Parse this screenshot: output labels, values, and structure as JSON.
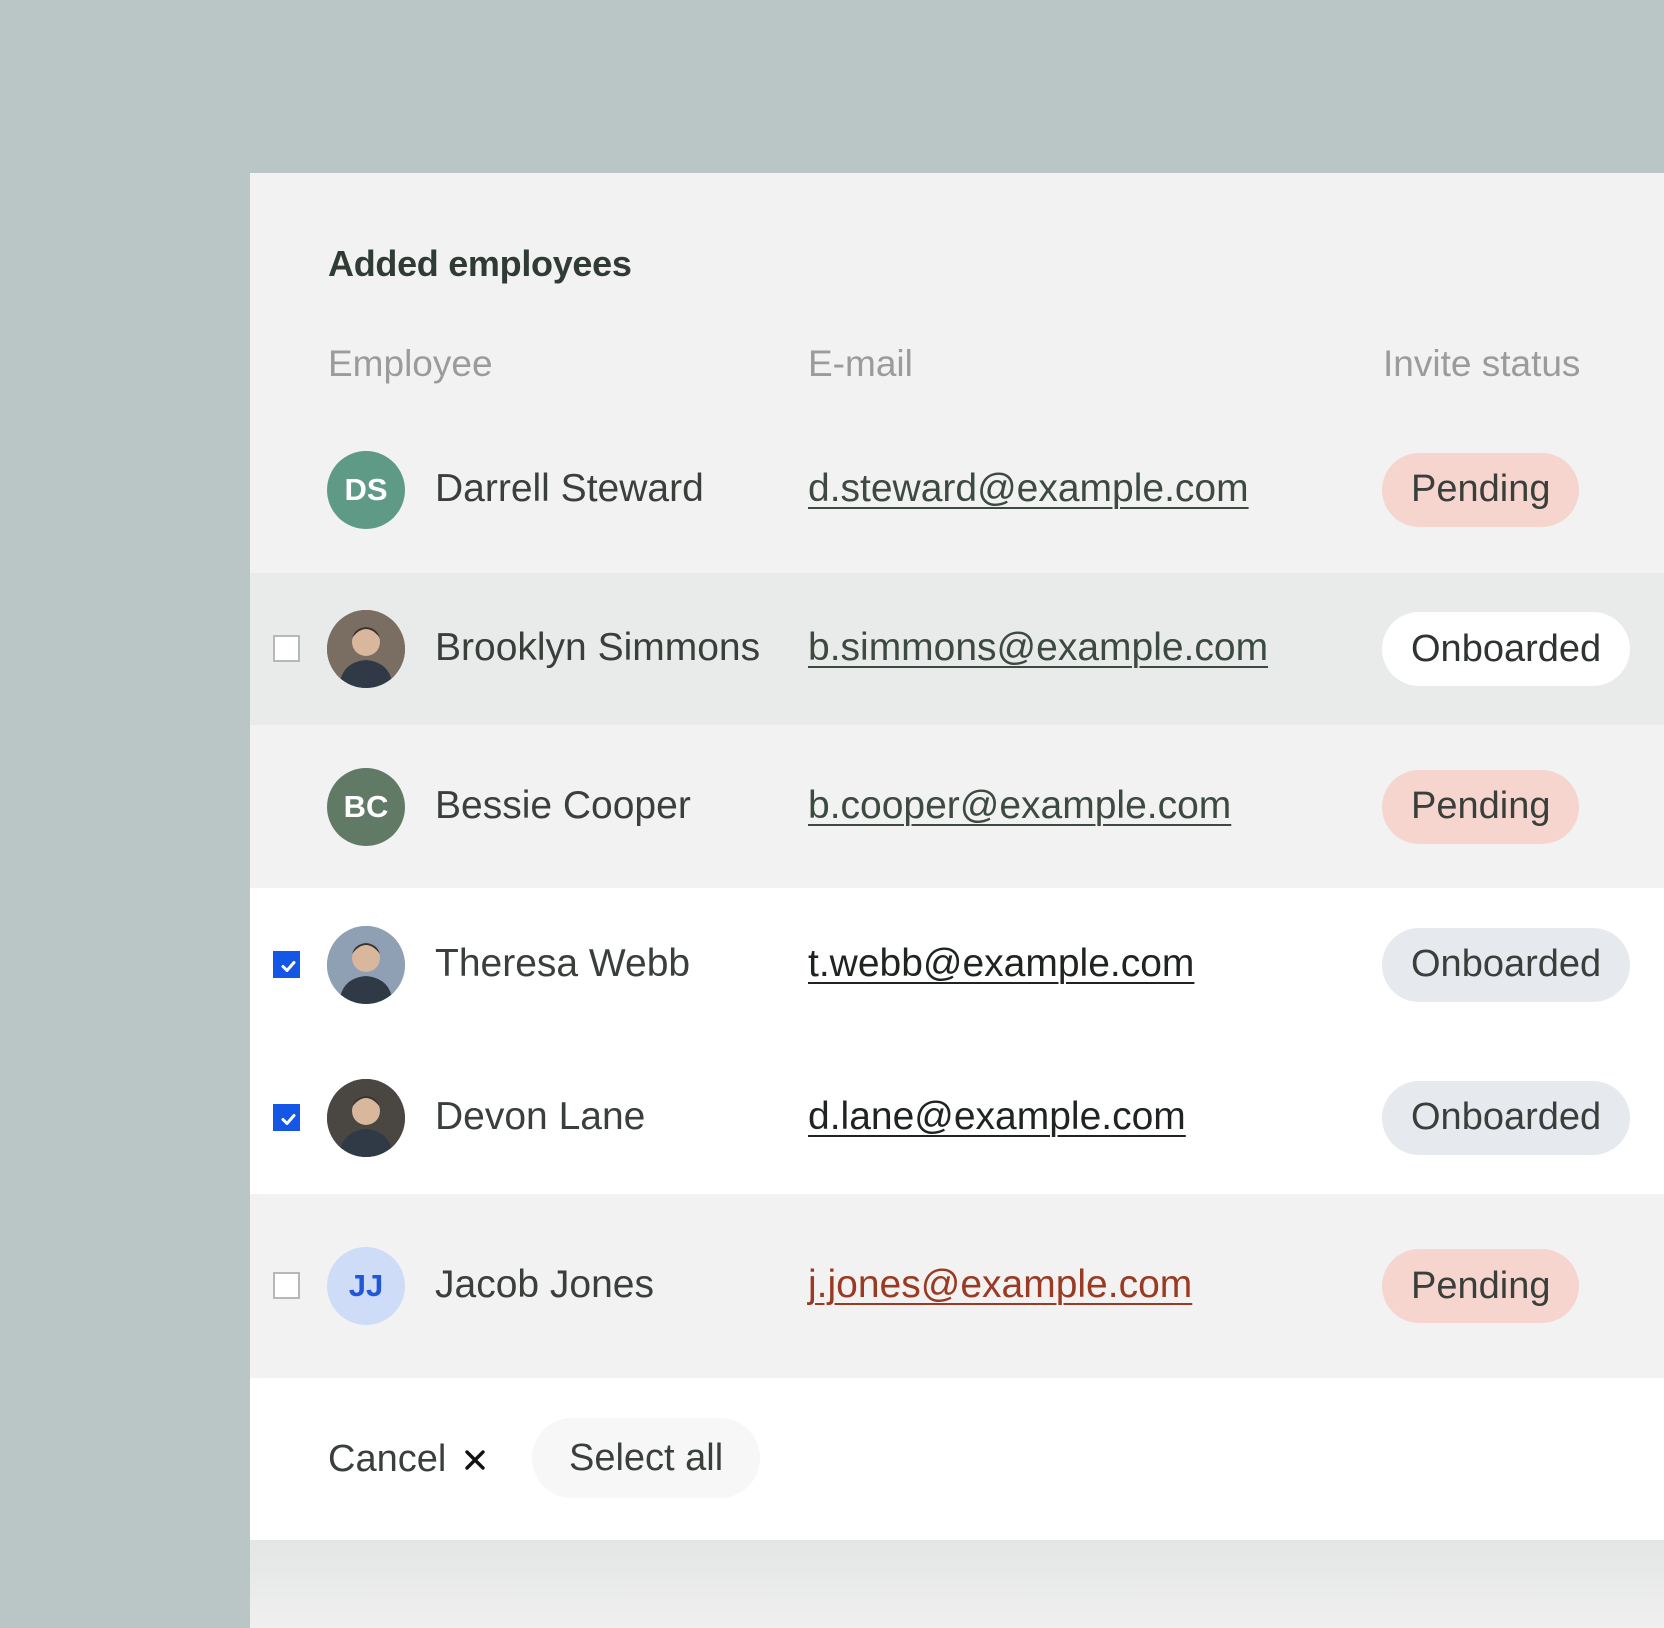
{
  "header": {
    "title": "Added employees"
  },
  "columns": {
    "employee": "Employee",
    "email": "E-mail",
    "status": "Invite status"
  },
  "rows": [
    {
      "name": "Darrell Steward",
      "email": "d.steward@example.com",
      "status": "Pending",
      "initials": "DS",
      "avatar_type": "initials",
      "avatar_bg": "#5f9a87",
      "avatar_fg": "#ffffff",
      "checkbox": "none",
      "row_bg": "#f2f2f2",
      "email_color": "#3d4a42",
      "badge_bg": "#f6d5cf",
      "badge_fg": "#3a3f3c"
    },
    {
      "name": "Brooklyn Simmons",
      "email": "b.simmons@example.com",
      "status": "Onboarded",
      "initials": "",
      "avatar_type": "photo",
      "avatar_bg": "#7a6e63",
      "avatar_fg": "#ffffff",
      "checkbox": "unchecked",
      "row_bg": "#e8ebe9",
      "email_color": "#3d4a42",
      "badge_bg": "#ffffff",
      "badge_fg": "#2f3431"
    },
    {
      "name": "Bessie Cooper",
      "email": "b.cooper@example.com",
      "status": "Pending",
      "initials": "BC",
      "avatar_type": "initials",
      "avatar_bg": "#617a66",
      "avatar_fg": "#ffffff",
      "checkbox": "none",
      "row_bg": "#f2f2f2",
      "email_color": "#3d4a42",
      "badge_bg": "#f6d5cf",
      "badge_fg": "#3a3f3c"
    },
    {
      "name": "Theresa Webb",
      "email": "t.webb@example.com",
      "status": "Onboarded",
      "initials": "",
      "avatar_type": "photo",
      "avatar_bg": "#8fa0b5",
      "avatar_fg": "#ffffff",
      "checkbox": "checked",
      "row_bg": "#ffffff",
      "email_color": "#1f2420",
      "badge_bg": "#e6e9ee",
      "badge_fg": "#3a3f3c"
    },
    {
      "name": "Devon Lane",
      "email": "d.lane@example.com",
      "status": "Onboarded",
      "initials": "",
      "avatar_type": "photo",
      "avatar_bg": "#4a4742",
      "avatar_fg": "#ffffff",
      "checkbox": "checked",
      "row_bg": "#ffffff",
      "email_color": "#1f2420",
      "badge_bg": "#e6e9ee",
      "badge_fg": "#3a3f3c"
    },
    {
      "name": "Jacob Jones",
      "email": "j.jones@example.com",
      "status": "Pending",
      "initials": "JJ",
      "avatar_type": "initials",
      "avatar_bg": "#cfdcf7",
      "avatar_fg": "#1f57d6",
      "checkbox": "unchecked",
      "row_bg": "#f2f2f2",
      "email_color": "#9a3a22",
      "badge_bg": "#f6d5cf",
      "badge_fg": "#3a3f3c"
    }
  ],
  "footer": {
    "cancel_label": "Cancel",
    "select_all_label": "Select all"
  },
  "icons": {
    "cancel": "close-icon",
    "check": "check-icon"
  }
}
